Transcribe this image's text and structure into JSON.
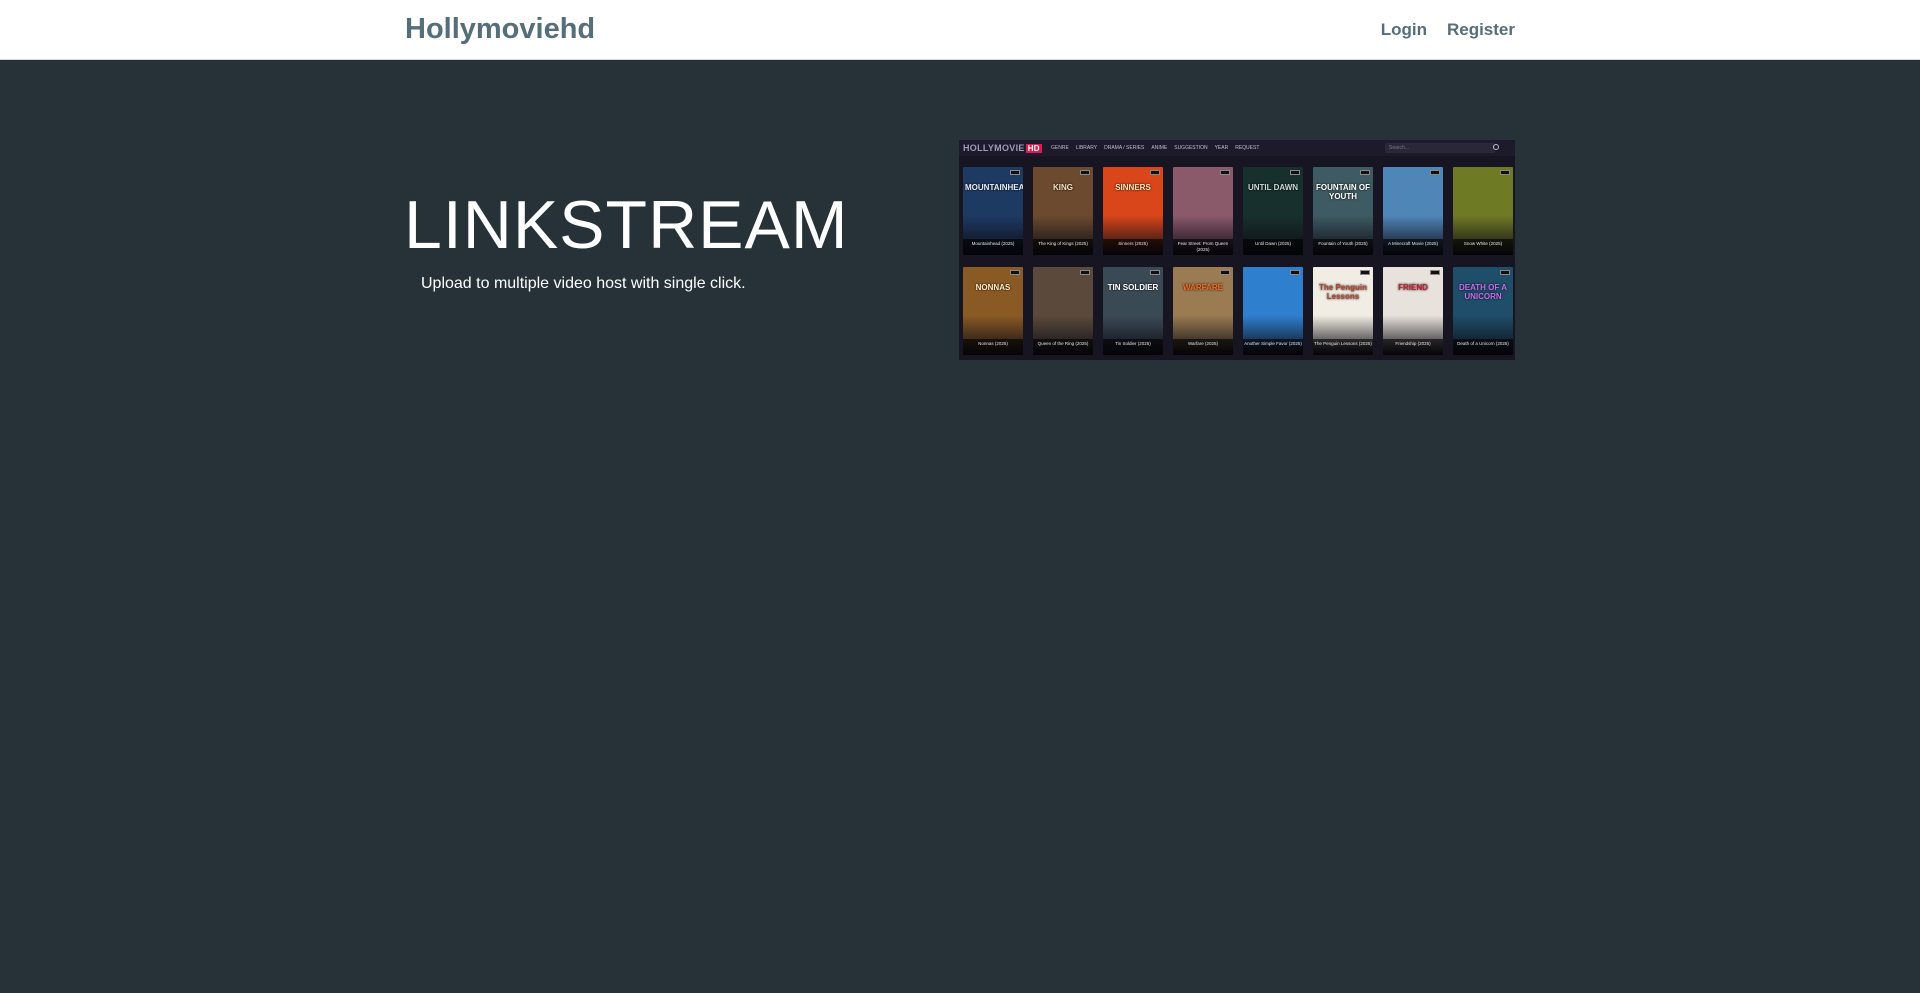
{
  "navbar": {
    "brand": "Hollymoviehd",
    "links": [
      {
        "label": "Login"
      },
      {
        "label": "Register"
      }
    ]
  },
  "hero": {
    "title": "LINKSTREAM",
    "subtitle": "Upload to multiple video host with single click."
  },
  "preview": {
    "logo": "HOLLYMOVIE",
    "logo_badge": "HD",
    "menu": [
      "Genre",
      "Library",
      "Drama / Series",
      "Anime",
      "Suggestion",
      "Year",
      "Request"
    ],
    "search_placeholder": "Search...",
    "posters": [
      {
        "title": "MOUNTAINHEAD",
        "caption": "Mountainhead (2025)",
        "color": "#1d3a63",
        "text_color": "#e8ecf5"
      },
      {
        "title": "KING",
        "caption": "The King of Kings (2025)",
        "color": "#6b4a2f",
        "text_color": "#f3e1c4"
      },
      {
        "title": "SINNERS",
        "caption": "Sinners (2025)",
        "color": "#d9461a",
        "text_color": "#ffe5b8"
      },
      {
        "title": "",
        "caption": "Fear Street: Prom Queen (2025)",
        "color": "#8a5a6b",
        "text_color": "#ffffff"
      },
      {
        "title": "UNTIL DAWN",
        "caption": "Until Dawn (2025)",
        "color": "#18302d",
        "text_color": "#c9d6d2"
      },
      {
        "title": "FOUNTAIN OF YOUTH",
        "caption": "Fountain of Youth (2025)",
        "color": "#3e5a62",
        "text_color": "#ffffff"
      },
      {
        "title": "",
        "caption": "A Minecraft Movie (2025)",
        "color": "#4f86b8",
        "text_color": "#ffffff"
      },
      {
        "title": "",
        "caption": "Snow White (2025)",
        "color": "#6f7a25",
        "text_color": "#ffffff"
      },
      {
        "title": "NONNAS",
        "caption": "Nonnas (2025)",
        "color": "#8a5a24",
        "text_color": "#ffe9c2"
      },
      {
        "title": "",
        "caption": "Queen of the Ring (2025)",
        "color": "#5b4a3c",
        "text_color": "#ffffff"
      },
      {
        "title": "TIN SOLDIER",
        "caption": "Tin Soldier (2025)",
        "color": "#3a4a55",
        "text_color": "#ffffff"
      },
      {
        "title": "WARFARE",
        "caption": "Warfare (2025)",
        "color": "#9a7b52",
        "text_color": "#f46b1f"
      },
      {
        "title": "",
        "caption": "Another Simple Favor (2025)",
        "color": "#2f7fcf",
        "text_color": "#ffffff"
      },
      {
        "title": "The Penguin Lessons",
        "caption": "The Penguin Lessons (2025)",
        "color": "#f1ede4",
        "text_color": "#b0452e"
      },
      {
        "title": "FRIEND",
        "caption": "Friendship (2025)",
        "color": "#e8e2dc",
        "text_color": "#c01f2a"
      },
      {
        "title": "DEATH OF A UNICORN",
        "caption": "Death of a Unicorn (2025)",
        "color": "#1f4e6a",
        "text_color": "#c86cf0"
      }
    ]
  }
}
